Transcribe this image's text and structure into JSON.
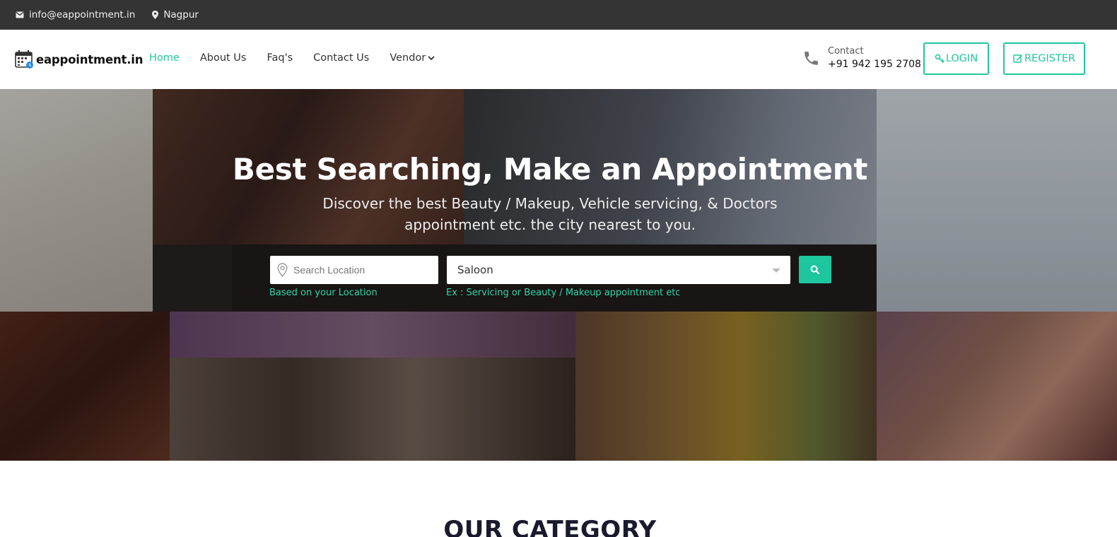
{
  "topbar": {
    "email": "info@eappointment.in",
    "location": "Nagpur"
  },
  "header": {
    "brand": "eappointment.in",
    "nav": [
      {
        "label": "Home",
        "active": true
      },
      {
        "label": "About Us",
        "active": false
      },
      {
        "label": "Faq's",
        "active": false
      },
      {
        "label": "Contact Us",
        "active": false
      },
      {
        "label": "Vendor",
        "active": false
      }
    ],
    "contact_label": "Contact",
    "contact_number": "+91 942 195 2708",
    "login_label": "LOGIN",
    "register_label": "REGISTER"
  },
  "hero": {
    "title": "Best Searching, Make an Appointment",
    "subtitle": "Discover the best Beauty / Makeup, Vehicle servicing, & Doctors appointment etc. the city nearest to you.",
    "location_placeholder": "Search Location",
    "category_value": "Saloon",
    "location_hint": "Based on your Location",
    "category_hint": "Ex : Servicing or Beauty / Makeup appointment etc"
  },
  "sections": {
    "category_title": "OUR CATEGORY"
  },
  "colors": {
    "accent": "#1ec6a0",
    "topbar_bg": "#343434",
    "hint": "#2fd4aa"
  }
}
